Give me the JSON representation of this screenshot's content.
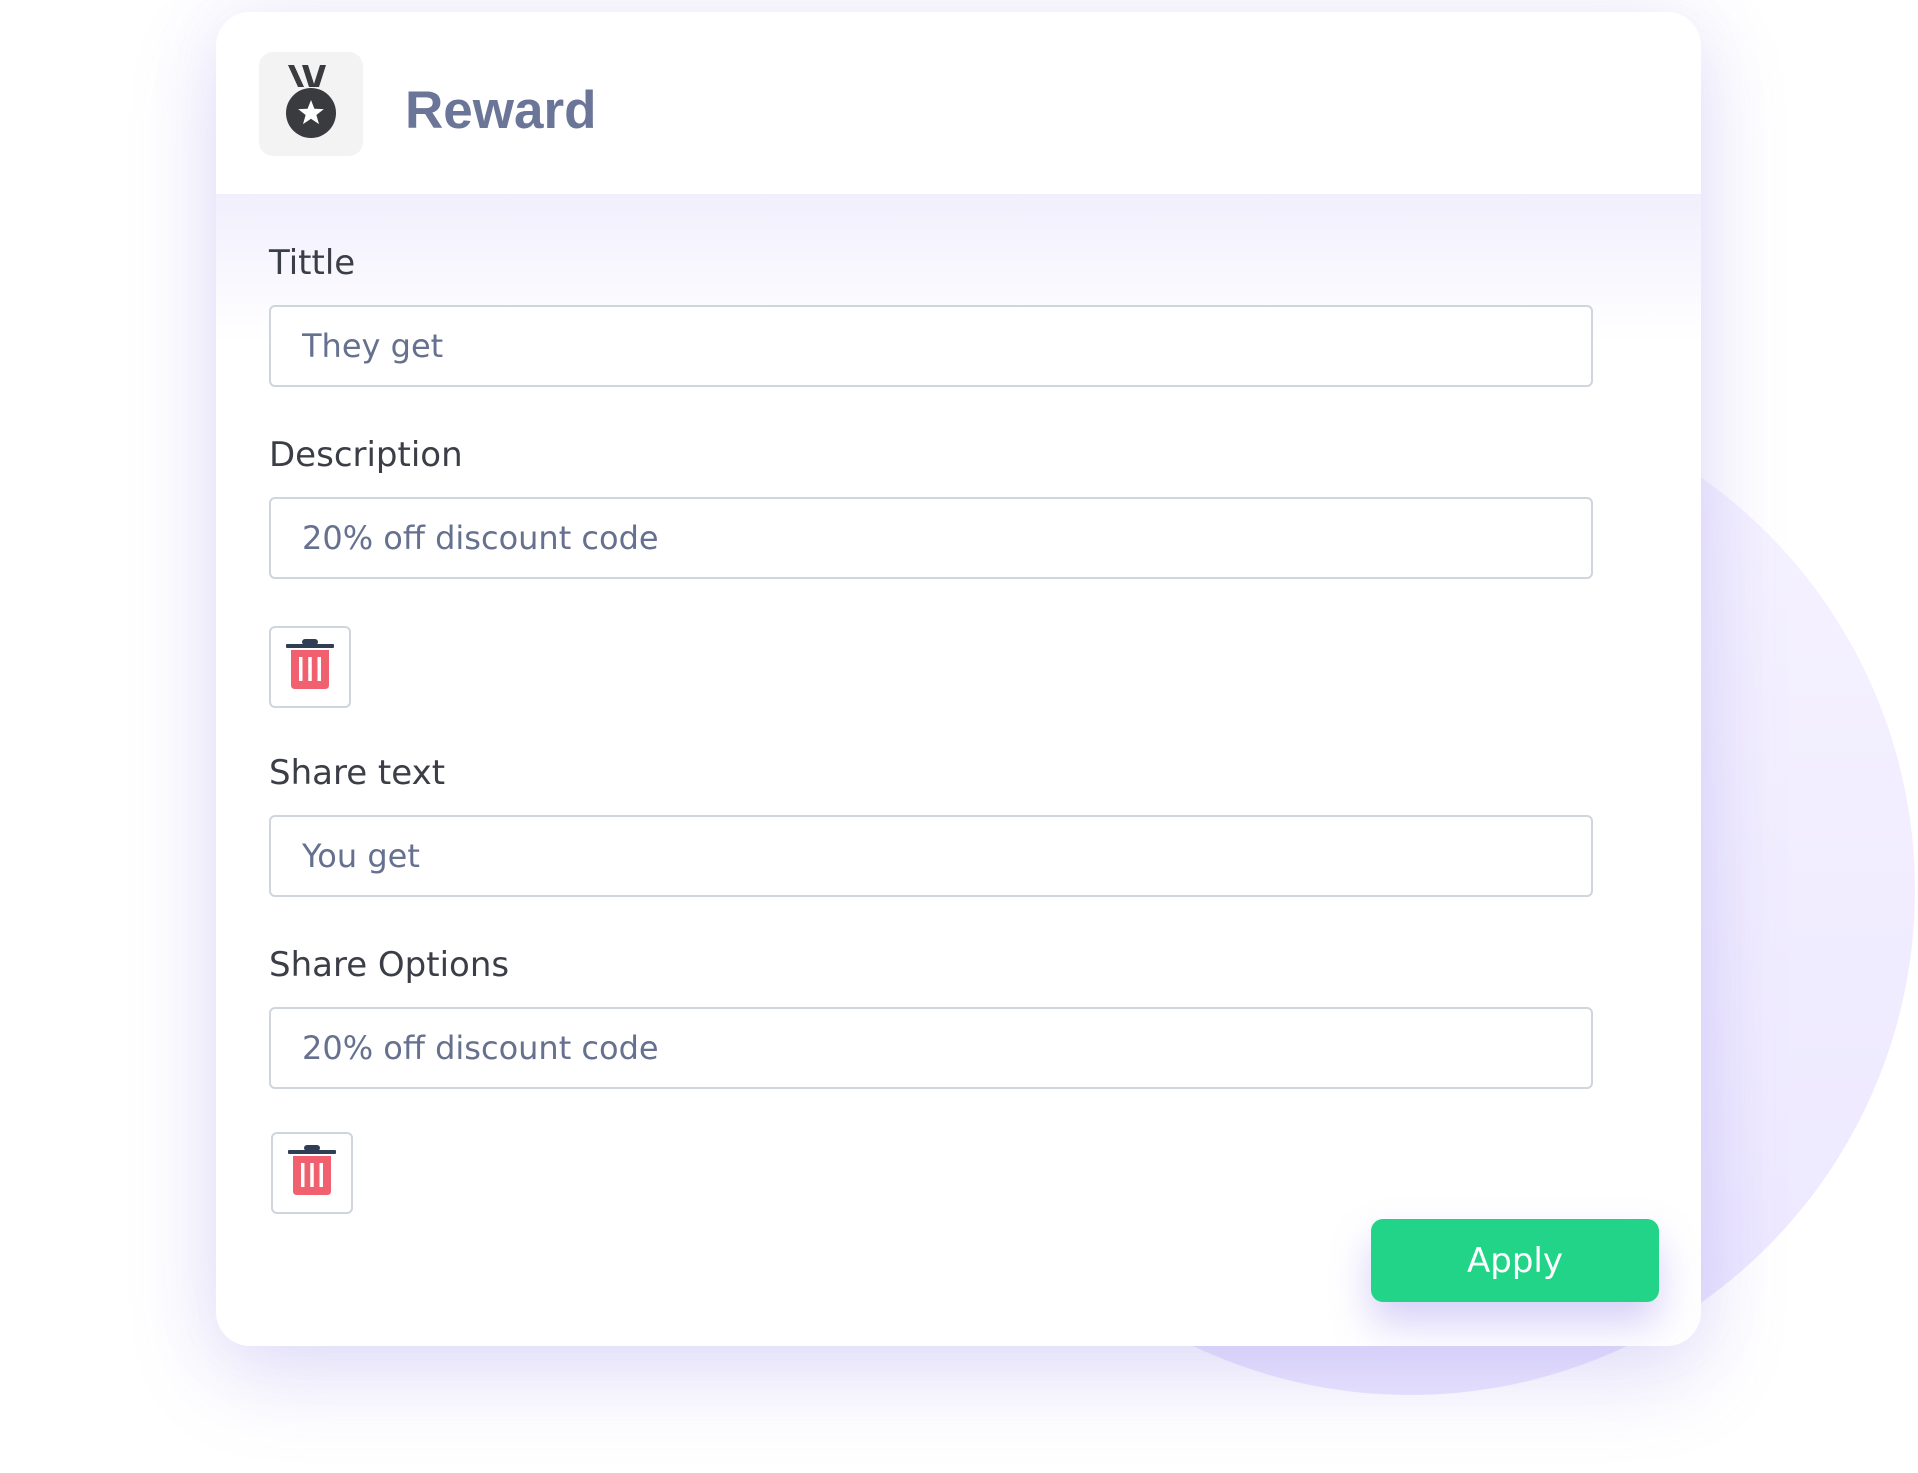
{
  "header": {
    "title": "Reward",
    "icon": "medal-icon"
  },
  "fields": [
    {
      "label": "Tittle",
      "value": "They get"
    },
    {
      "label": "Description",
      "value": "20% off discount code"
    },
    {
      "label": "Share text",
      "value": "You get"
    },
    {
      "label": "Share Options",
      "value": "20% off discount code"
    }
  ],
  "actions": {
    "delete_icon": "trash-icon",
    "apply_label": "Apply"
  },
  "colors": {
    "accent": "#21d488",
    "title": "#6a7598",
    "delete": "#f0606f",
    "background_shape": "#ece7ff"
  }
}
